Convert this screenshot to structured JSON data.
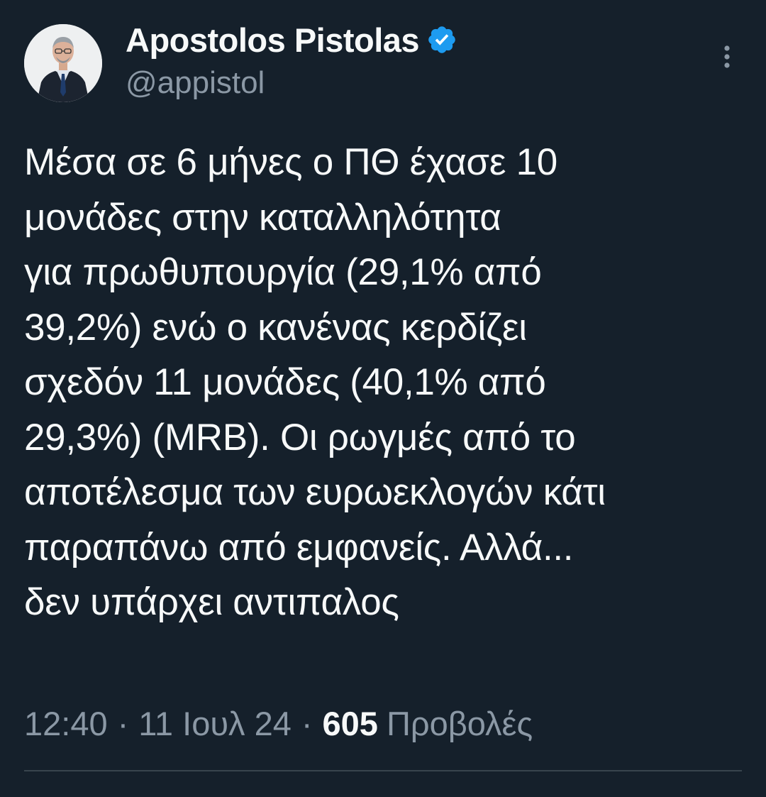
{
  "author": {
    "display_name": "Apostolos Pistolas",
    "handle": "@appistol",
    "verified": true
  },
  "tweet": {
    "lines": [
      "Μέσα σε 6 μήνες ο ΠΘ έχασε 10",
      "μονάδες στην καταλληλότητα",
      "για πρωθυπουργία (29,1% από",
      "39,2%) ενώ ο κανένας κερδίζει",
      "σχεδόν 11 μονάδες (40,1% από",
      "29,3%) (MRB). Οι ρωγμές από το",
      "αποτέλεσμα των ευρωεκλογών κάτι",
      "παραπάνω από εμφανείς. Αλλά...",
      "δεν υπάρχει αντιπαλος"
    ]
  },
  "meta": {
    "time": "12:40",
    "separator": "·",
    "date": "11 Ιουλ 24",
    "views_count": "605",
    "views_label": "Προβολές"
  },
  "icons": {
    "verified": "verified-badge-icon",
    "more": "more-vertical-icon"
  },
  "colors": {
    "background": "#15202b",
    "text_primary": "#f7f9f9",
    "text_secondary": "#8b98a5",
    "verified_blue": "#1d9bf0",
    "divider": "#38444d"
  }
}
